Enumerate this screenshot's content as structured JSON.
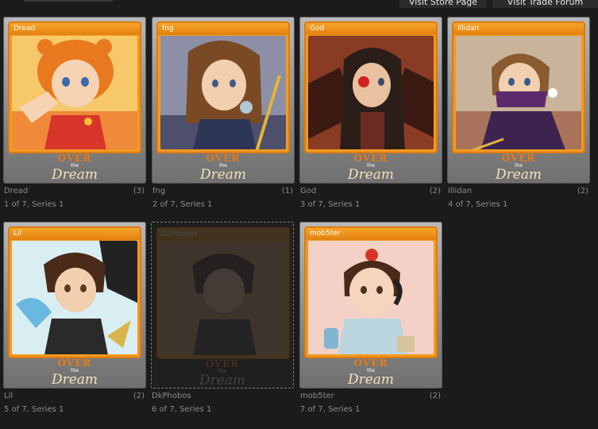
{
  "topbar": {
    "store_btn": "Visit Store Page",
    "trade_btn": "Visit Trade Forum"
  },
  "logo": {
    "over": "OVER",
    "the": "the",
    "dream": "Dream"
  },
  "cards": [
    {
      "name": "Dread",
      "count": "(3)",
      "series": "1 of 7, Series 1",
      "owned": true
    },
    {
      "name": "fng",
      "count": "(1)",
      "series": "2 of 7, Series 1",
      "owned": true
    },
    {
      "name": "God",
      "count": "(2)",
      "series": "3 of 7, Series 1",
      "owned": true
    },
    {
      "name": "Illidan",
      "count": "(2)",
      "series": "4 of 7, Series 1",
      "owned": true
    },
    {
      "name": "Lil",
      "count": "(2)",
      "series": "5 of 7, Series 1",
      "owned": true
    },
    {
      "name": "DkPhobos",
      "count": "",
      "series": "6 of 7, Series 1",
      "owned": false
    },
    {
      "name": "mob5ter",
      "count": "(2)",
      "series": "7 of 7, Series 1",
      "owned": true
    }
  ],
  "colors": {
    "accent": "#f39a1e",
    "text_muted": "#8b8b8b",
    "background": "#1b1b1c"
  }
}
